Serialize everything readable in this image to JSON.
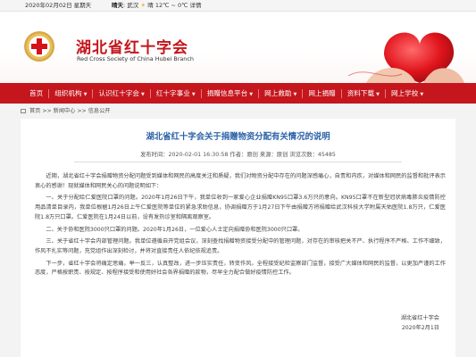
{
  "topbar": {
    "date": "2020年02月02日 星期天",
    "weather_label": "晴天",
    "city": "武汉",
    "weather": "晴",
    "temp": "12℃ ~ 0℃",
    "detail": "详情"
  },
  "header": {
    "title": "湖北省红十字会",
    "subtitle": "Red Cross Society of China Hubei Branch"
  },
  "nav": {
    "items": [
      {
        "label": "首页",
        "dropdown": false
      },
      {
        "label": "组织机构",
        "dropdown": true
      },
      {
        "label": "认识红十字会",
        "dropdown": true
      },
      {
        "label": "红十字事业",
        "dropdown": true
      },
      {
        "label": "捐赠信息平台",
        "dropdown": true
      },
      {
        "label": "网上救助",
        "dropdown": true
      },
      {
        "label": "网上捐赠",
        "dropdown": false
      },
      {
        "label": "资料下载",
        "dropdown": true
      },
      {
        "label": "网上学校",
        "dropdown": true
      }
    ]
  },
  "breadcrumb": {
    "home": "首页",
    "sep": ">>",
    "news": "新闻中心",
    "current": "信息公开"
  },
  "article": {
    "title": "湖北省红十字会关于捐赠物资分配有关情况的说明",
    "meta": "发布时间：2020-02-01 16:30:58   作者：原创   来源：原创   浏览次数：45485",
    "paragraphs": [
      "近期，湖北省红十字会捐赠物资分配问题受到媒体和网民的高度关注和质疑，我们对物资分配中存在的问题深感痛心，自责和内疚，对媒体和网民的监督和批评表示衷心的感谢！现就媒体和网民关心的问题说明如下：",
      "一、关于分配给仁爱医院口罩的问题。2020年1月26日下午，我单位收到一家爱心企业捐赠KN95口罩3.6万只的意向。KN95口罩不在新型冠状病毒肺炎疫情防控用品清单目录内，我单位根据1月26日上午仁爱医院等单位的紧急求助信息，协调捐赠方于1月27日下午由捐赠方将捐赠给武汉科技大学附属天佑医院1.8万只，仁爱医院1.8万只口罩。仁爱医院在1月24日以前，设有发热诊室和隔离观察室。",
      "二、关于协和医院3000只口罩的问题。2020年1月26日，一位爱心人士定向捐赠协和医院3000只口罩。",
      "三、关于省红十字会内部管理问题。我单位遵循自开党组会议，深刻查找捐赠物资接受分配中的管理问题，对存在的审核把关不严、执行程序不严格、工作不细致，作风不扎实等问题，充党组作出深刻检讨，并将对直接责任人依纪依规追责。",
      "下一步，省红十字会将痛定思痛，举一反三，认真整改，进一步压实责任，转变作风，全程接受纪检监察部门监督，接受广大媒体和网民的监督，以更加严谨的工作态度，严格按职责、按规定、按程序接受和使用好社会各界捐赠的款物，尽早全力配合做好疫情防控工作。"
    ],
    "sign_org": "湖北省红十字会",
    "sign_date": "2020年2月1日"
  },
  "colors": {
    "brand_red": "#c5161d",
    "title_blue": "#2d63a8"
  }
}
